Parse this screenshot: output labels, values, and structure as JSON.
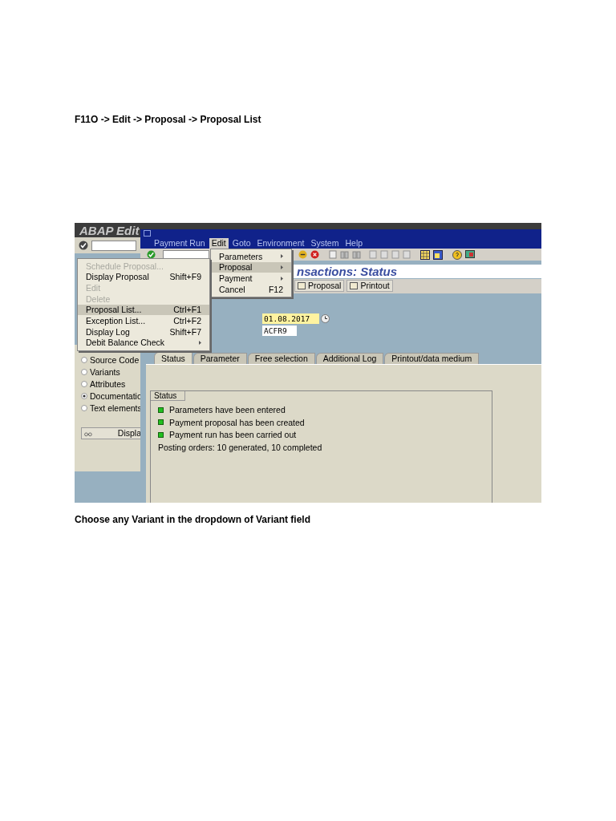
{
  "instruction": "F11O -> Edit -> Proposal -> Proposal List",
  "screenshot": {
    "back_window": {
      "title": "ABAP Edit",
      "subobjects": [
        {
          "label": "Source Code",
          "selected": false
        },
        {
          "label": "Variants",
          "selected": false
        },
        {
          "label": "Attributes",
          "selected": false
        },
        {
          "label": "Documentatio",
          "selected": true
        },
        {
          "label": "Text elements",
          "selected": false
        }
      ],
      "display_button": "Displa"
    },
    "front_window": {
      "menu_bar": [
        {
          "label": "Payment Run",
          "selected": false
        },
        {
          "label": "Edit",
          "selected": true
        },
        {
          "label": "Goto",
          "selected": false
        },
        {
          "label": "Environment",
          "selected": false
        },
        {
          "label": "System",
          "selected": false
        },
        {
          "label": "Help",
          "selected": false
        }
      ],
      "title": "nsactions: Status",
      "toolbar_buttons": [
        "Proposal",
        "Printout"
      ],
      "fields": [
        {
          "value": "01.08.2017",
          "kind": "required"
        },
        {
          "value": "ACFR9",
          "kind": "plain"
        }
      ],
      "tabs": [
        {
          "label": "Status",
          "selected": true
        },
        {
          "label": "Parameter",
          "selected": false
        },
        {
          "label": "Free selection",
          "selected": false
        },
        {
          "label": "Additional Log",
          "selected": false
        },
        {
          "label": "Printout/data medium",
          "selected": false
        }
      ],
      "status_group": {
        "title": "Status",
        "items": [
          "Parameters have been entered",
          "Payment proposal has been created",
          "Payment run has been carried out"
        ],
        "note": "Posting orders: 10 generated, 10 completed"
      }
    },
    "edit_menu": [
      {
        "label": "Parameters",
        "submenu": true,
        "selected": false
      },
      {
        "label": "Proposal",
        "submenu": true,
        "selected": true
      },
      {
        "label": "Payment",
        "submenu": true,
        "selected": false
      },
      {
        "label": "Cancel",
        "shortcut": "F12",
        "selected": false
      }
    ],
    "proposal_menu": [
      {
        "label": "Schedule Proposal...",
        "disabled": true,
        "selected": false
      },
      {
        "label": "Display Proposal",
        "shortcut": "Shift+F9",
        "disabled": false,
        "selected": false
      },
      {
        "label": "Edit",
        "disabled": true,
        "selected": false
      },
      {
        "label": "Delete",
        "disabled": true,
        "selected": false
      },
      {
        "label": "Proposal List...",
        "shortcut": "Ctrl+F1",
        "disabled": false,
        "selected": true
      },
      {
        "label": "Exception List...",
        "shortcut": "Ctrl+F2",
        "disabled": false,
        "selected": false
      },
      {
        "label": "Display Log",
        "shortcut": "Shift+F7",
        "disabled": false,
        "selected": false
      },
      {
        "label": "Debit Balance Check",
        "disabled": false,
        "selected": false,
        "submenu": true
      }
    ]
  },
  "caption": "Choose any Variant in the dropdown of Variant field"
}
